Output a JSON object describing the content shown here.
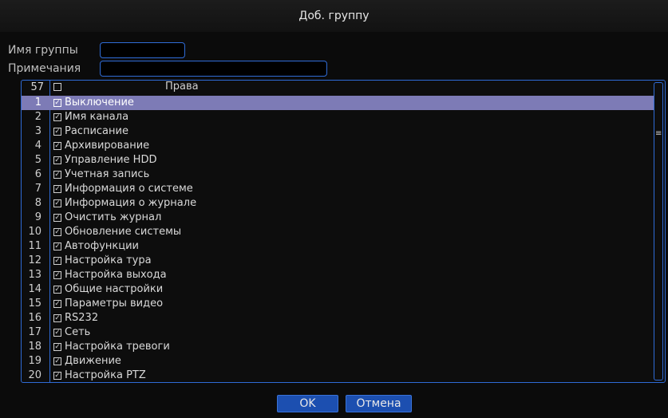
{
  "dialog": {
    "title": "Доб. группу",
    "group_name_label": "Имя группы",
    "group_name_value": "",
    "notes_label": "Примечания",
    "notes_value": ""
  },
  "rights_list": {
    "count": "57",
    "header_title": "Права",
    "selected_index": 0,
    "items": [
      {
        "num": "1",
        "label": "Выключение",
        "checked": true
      },
      {
        "num": "2",
        "label": "Имя канала",
        "checked": true
      },
      {
        "num": "3",
        "label": "Расписание",
        "checked": true
      },
      {
        "num": "4",
        "label": "Архивирование",
        "checked": true
      },
      {
        "num": "5",
        "label": "Управление HDD",
        "checked": true
      },
      {
        "num": "6",
        "label": "Учетная запись",
        "checked": true
      },
      {
        "num": "7",
        "label": "Информация о системе",
        "checked": true
      },
      {
        "num": "8",
        "label": "Информация о журнале",
        "checked": true
      },
      {
        "num": "9",
        "label": "Очистить журнал",
        "checked": true
      },
      {
        "num": "10",
        "label": "Обновление системы",
        "checked": true
      },
      {
        "num": "11",
        "label": "Автофункции",
        "checked": true
      },
      {
        "num": "12",
        "label": "Настройка тура",
        "checked": true
      },
      {
        "num": "13",
        "label": "Настройка выхода",
        "checked": true
      },
      {
        "num": "14",
        "label": "Общие настройки",
        "checked": true
      },
      {
        "num": "15",
        "label": "Параметры видео",
        "checked": true
      },
      {
        "num": "16",
        "label": "RS232",
        "checked": true
      },
      {
        "num": "17",
        "label": "Сеть",
        "checked": true
      },
      {
        "num": "18",
        "label": "Настройка тревоги",
        "checked": true
      },
      {
        "num": "19",
        "label": "Движение",
        "checked": true
      },
      {
        "num": "20",
        "label": "Настройка PTZ",
        "checked": true
      }
    ]
  },
  "buttons": {
    "ok_label": "OK",
    "cancel_label": "Отмена"
  },
  "colors": {
    "accent": "#2f6bd6",
    "selected_row": "#7d7bb6",
    "button": "#1c4fb0"
  }
}
